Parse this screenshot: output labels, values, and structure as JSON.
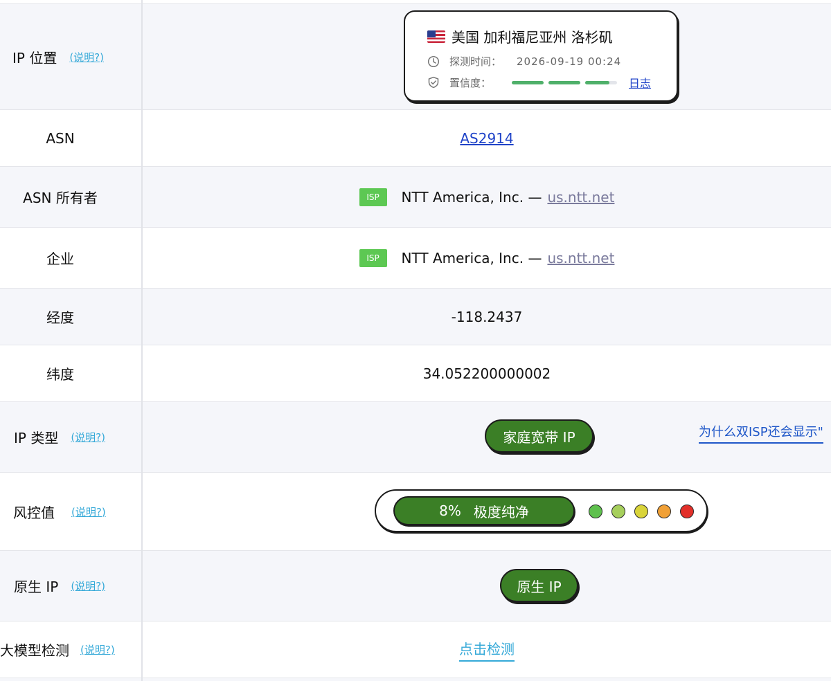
{
  "help_label": "(说明?)",
  "rows": {
    "ip_location": {
      "label": "IP 位置",
      "location": "美国 加利福尼亚州 洛杉矶",
      "detect_time_label": "探测时间：",
      "detect_time": "2026-09-19 00:24",
      "confidence_label": "置信度：",
      "confidence_fraction": 0.92,
      "log_link": "日志"
    },
    "asn": {
      "label": "ASN",
      "value": "AS2914"
    },
    "asn_owner": {
      "label": "ASN 所有者",
      "badge": "ISP",
      "name": "NTT America, Inc. —",
      "domain": "us.ntt.net"
    },
    "company": {
      "label": "企业",
      "badge": "ISP",
      "name": "NTT America, Inc. —",
      "domain": "us.ntt.net"
    },
    "longitude": {
      "label": "经度",
      "value": "-118.2437"
    },
    "latitude": {
      "label": "纬度",
      "value": "34.052200000002"
    },
    "ip_type": {
      "label": "IP 类型",
      "value": "家庭宽带 IP",
      "why_link": "为什么双ISP还会显示\""
    },
    "risk": {
      "label": "风控值",
      "percent": "8%",
      "level": "极度纯净",
      "dot_colors": [
        "#5ec04d",
        "#a6cf5c",
        "#d9d43a",
        "#f0a036",
        "#e2302a"
      ]
    },
    "native_ip": {
      "label": "原生 IP",
      "value": "原生 IP"
    },
    "llm_detect": {
      "label": "大模型检测",
      "value": "点击检测"
    }
  },
  "colors": {
    "accent_green": "#3b7f26",
    "isp_badge": "#5dc853",
    "link_blue": "#1f43c8",
    "help_cyan": "#35a9d8",
    "row_alt": "#f5f6fa"
  }
}
